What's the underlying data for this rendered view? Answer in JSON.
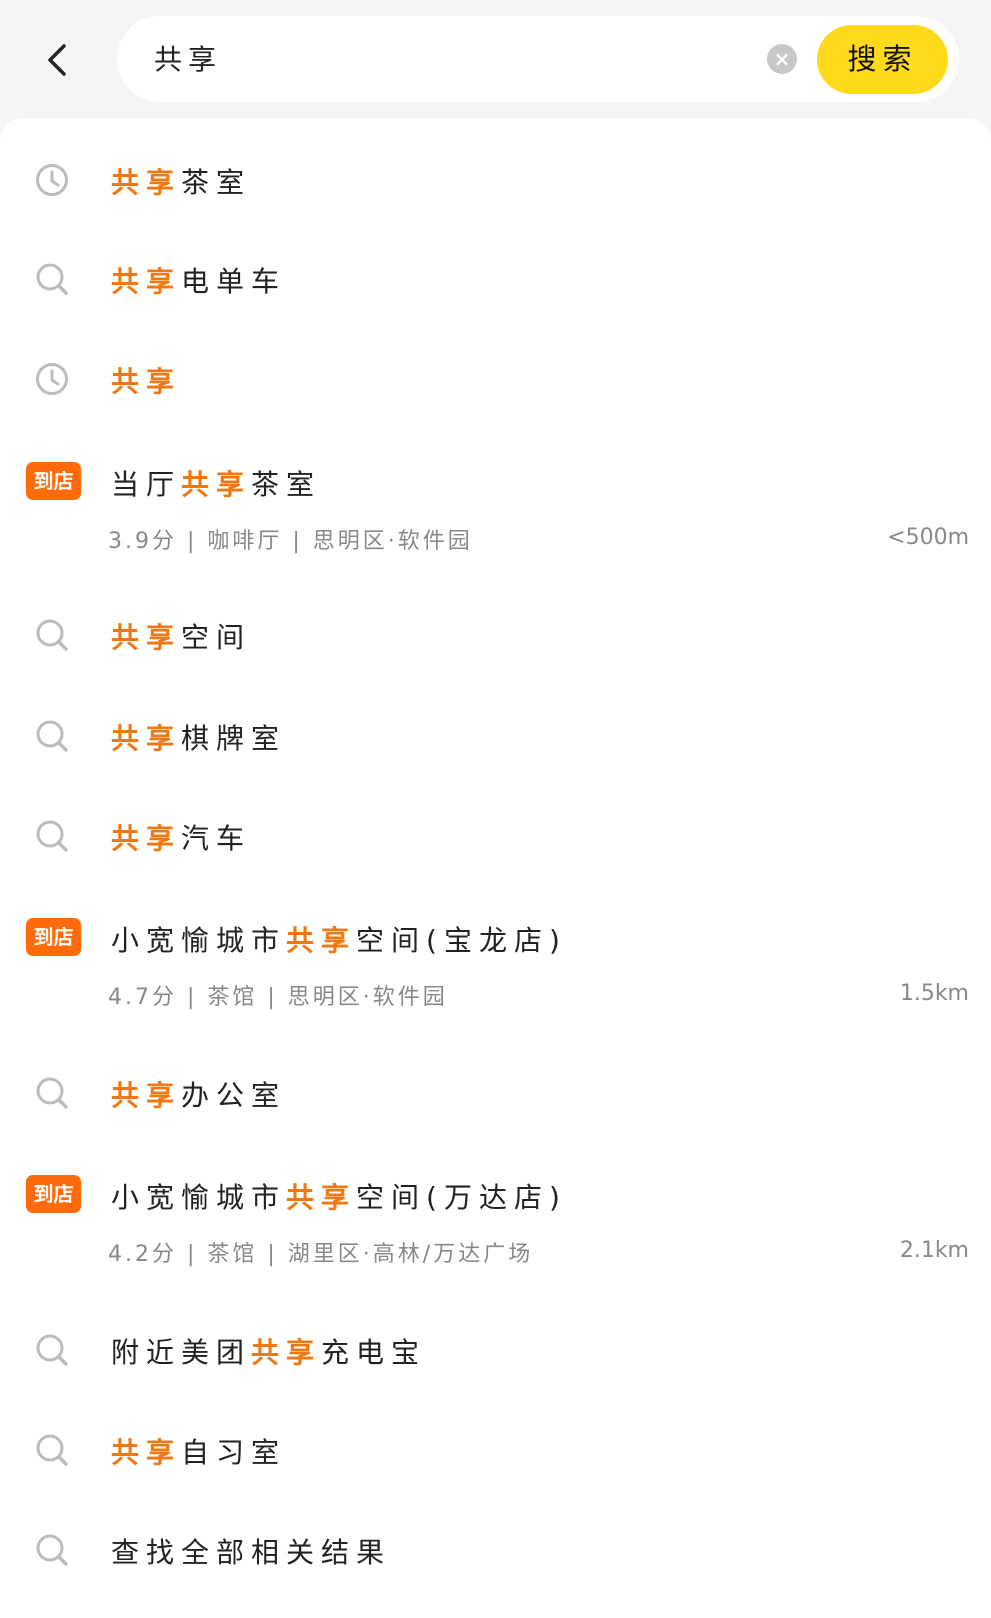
{
  "header": {
    "query": "共享",
    "search_button": "搜索",
    "back_icon": "chevron-left-icon",
    "clear_icon": "clear-circle-icon"
  },
  "colors": {
    "highlight": "#F07812",
    "search_button": "#FFD91C",
    "badge": "#FF6A0A"
  },
  "suggestions": [
    {
      "type": "history",
      "icon": "clock-icon",
      "parts": [
        {
          "t": "共享",
          "hl": true
        },
        {
          "t": "茶室",
          "hl": false
        }
      ]
    },
    {
      "type": "search",
      "icon": "search-icon",
      "parts": [
        {
          "t": "共享",
          "hl": true
        },
        {
          "t": "电单车",
          "hl": false
        }
      ]
    },
    {
      "type": "history",
      "icon": "clock-icon",
      "parts": [
        {
          "t": "共享",
          "hl": true
        }
      ]
    },
    {
      "type": "store",
      "badge": "到店",
      "parts": [
        {
          "t": "当厅",
          "hl": false
        },
        {
          "t": "共享",
          "hl": true
        },
        {
          "t": "茶室",
          "hl": false
        }
      ],
      "meta": "3.9分 | 咖啡厅 | 思明区·软件园",
      "distance": "<500m"
    },
    {
      "type": "search",
      "icon": "search-icon",
      "parts": [
        {
          "t": "共享",
          "hl": true
        },
        {
          "t": "空间",
          "hl": false
        }
      ]
    },
    {
      "type": "search",
      "icon": "search-icon",
      "parts": [
        {
          "t": "共享",
          "hl": true
        },
        {
          "t": "棋牌室",
          "hl": false
        }
      ]
    },
    {
      "type": "search",
      "icon": "search-icon",
      "parts": [
        {
          "t": "共享",
          "hl": true
        },
        {
          "t": "汽车",
          "hl": false
        }
      ]
    },
    {
      "type": "store",
      "badge": "到店",
      "parts": [
        {
          "t": "小宽愉城市",
          "hl": false
        },
        {
          "t": "共享",
          "hl": true
        },
        {
          "t": "空间(宝龙店)",
          "hl": false
        }
      ],
      "meta": "4.7分 | 茶馆 | 思明区·软件园",
      "distance": "1.5km"
    },
    {
      "type": "search",
      "icon": "search-icon",
      "parts": [
        {
          "t": "共享",
          "hl": true
        },
        {
          "t": "办公室",
          "hl": false
        }
      ]
    },
    {
      "type": "store",
      "badge": "到店",
      "parts": [
        {
          "t": "小宽愉城市",
          "hl": false
        },
        {
          "t": "共享",
          "hl": true
        },
        {
          "t": "空间(万达店)",
          "hl": false
        }
      ],
      "meta": "4.2分 | 茶馆 | 湖里区·高林/万达广场",
      "distance": "2.1km"
    },
    {
      "type": "search",
      "icon": "search-icon",
      "parts": [
        {
          "t": "附近美团",
          "hl": false
        },
        {
          "t": "共享",
          "hl": true
        },
        {
          "t": "充电宝",
          "hl": false
        }
      ]
    },
    {
      "type": "search",
      "icon": "search-icon",
      "parts": [
        {
          "t": "共享",
          "hl": true
        },
        {
          "t": "自习室",
          "hl": false
        }
      ]
    },
    {
      "type": "search",
      "icon": "search-icon",
      "parts": [
        {
          "t": "查找全部相关结果",
          "hl": false
        }
      ]
    }
  ]
}
